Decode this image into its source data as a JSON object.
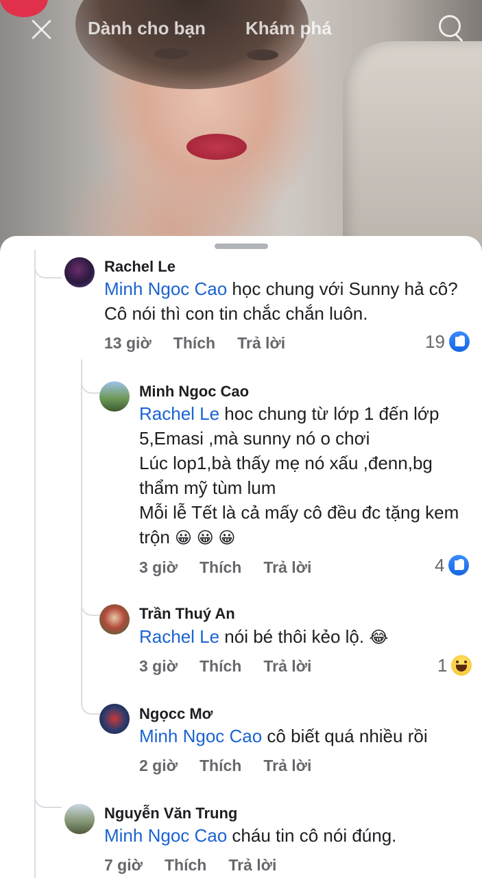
{
  "top_bar": {
    "tab_for_you": "Dành cho bạn",
    "tab_explore": "Khám phá"
  },
  "icons": {
    "close": "close-icon",
    "search": "search-icon",
    "like": "like-icon",
    "haha": "haha-icon"
  },
  "colors": {
    "mention": "#1a63d1",
    "meta": "#65676b",
    "like_blue": "#1877f2"
  },
  "comments": [
    {
      "author": "Rachel Le",
      "mention": "Minh Ngoc Cao",
      "text": " học chung với Sunny hả cô? Cô nói thì con tin chắc chắn luôn.",
      "time": "13 giờ",
      "like": "Thích",
      "reply": "Trả lời",
      "reaction_count": "19"
    },
    {
      "author": "Minh Ngoc Cao",
      "mention": "Rachel Le",
      "text": " hoc chung từ lớp 1 đến lớp 5,Emasi ,mà sunny nó o chơi\nLúc lop1,bà thấy mẹ nó xấu ,đenn,bg thẩm mỹ tùm lum\nMỗi lễ Tết là cả mấy cô đều đc tặng kem trộn ",
      "emojis": "😀 😀 😀",
      "time": "3 giờ",
      "like": "Thích",
      "reply": "Trả lời",
      "reaction_count": "4"
    },
    {
      "author": "Trần Thuý An",
      "mention": "Rachel Le",
      "text": " nói bé thôi kẻo lộ. ",
      "emojis": "😂",
      "time": "3 giờ",
      "like": "Thích",
      "reply": "Trả lời",
      "reaction_count": "1"
    },
    {
      "author": "Ngọcc Mơ",
      "mention": "Minh Ngoc Cao",
      "text": " cô biết quá nhiều rồi",
      "time": "2 giờ",
      "like": "Thích",
      "reply": "Trả lời"
    },
    {
      "author": "Nguyễn Văn Trung",
      "mention": "Minh Ngoc Cao",
      "text": " cháu tin cô nói đúng.",
      "time": "7 giờ",
      "like": "Thích",
      "reply": "Trả lời"
    }
  ]
}
